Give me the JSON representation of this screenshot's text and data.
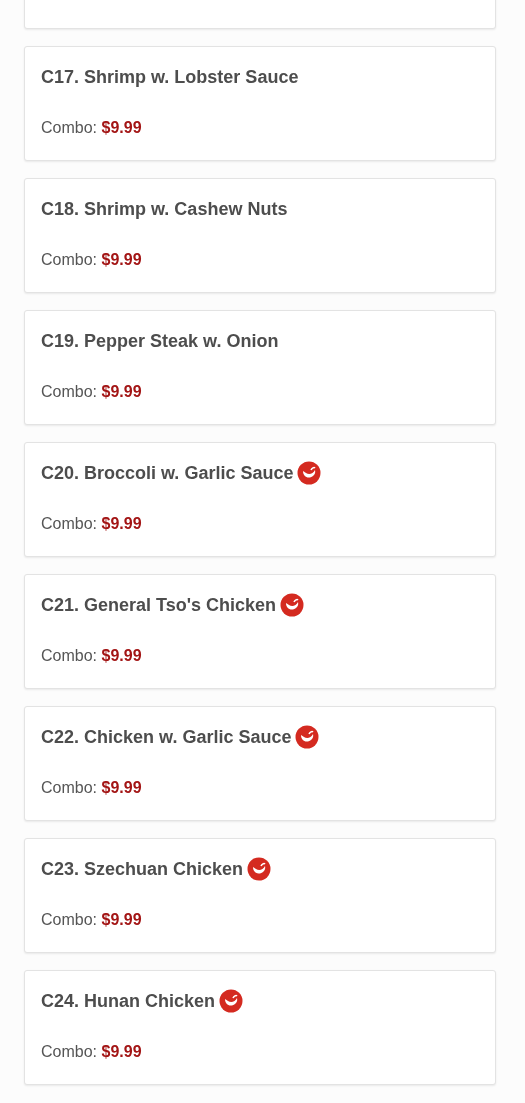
{
  "menu_items": [
    {
      "name": "C17. Shrimp w. Lobster Sauce",
      "combo_label": "Combo:",
      "price": "$9.99",
      "spicy": false
    },
    {
      "name": "C18. Shrimp w. Cashew Nuts",
      "combo_label": "Combo:",
      "price": "$9.99",
      "spicy": false
    },
    {
      "name": "C19. Pepper Steak w. Onion",
      "combo_label": "Combo:",
      "price": "$9.99",
      "spicy": false
    },
    {
      "name": "C20. Broccoli w. Garlic Sauce",
      "combo_label": "Combo:",
      "price": "$9.99",
      "spicy": true
    },
    {
      "name": "C21. General Tso's Chicken",
      "combo_label": "Combo:",
      "price": "$9.99",
      "spicy": true
    },
    {
      "name": "C22. Chicken w. Garlic Sauce",
      "combo_label": "Combo:",
      "price": "$9.99",
      "spicy": true
    },
    {
      "name": "C23. Szechuan Chicken",
      "combo_label": "Combo:",
      "price": "$9.99",
      "spicy": true
    },
    {
      "name": "C24. Hunan Chicken",
      "combo_label": "Combo:",
      "price": "$9.99",
      "spicy": true
    }
  ]
}
